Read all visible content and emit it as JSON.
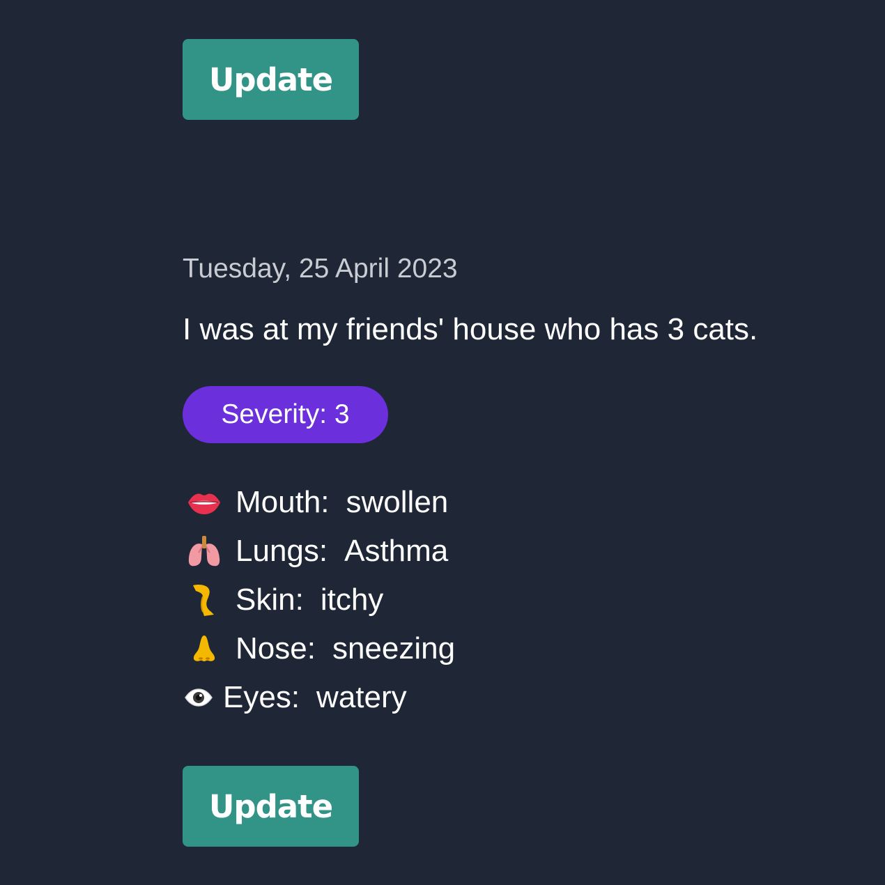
{
  "buttons": {
    "update_top": "Update",
    "update_bottom": "Update"
  },
  "entry": {
    "date": "Tuesday, 25 April 2023",
    "note": "I was at my friends' house who has 3 cats.",
    "severity": "Severity: 3",
    "symptoms": [
      {
        "icon": "lips-icon",
        "part": "Mouth:",
        "value": "swollen"
      },
      {
        "icon": "lungs-icon",
        "part": "Lungs:",
        "value": "Asthma"
      },
      {
        "icon": "leg-icon",
        "part": "Skin:",
        "value": "itchy"
      },
      {
        "icon": "nose-icon",
        "part": "Nose:",
        "value": "sneezing"
      },
      {
        "icon": "eye-icon",
        "part": "Eyes:",
        "value": "watery"
      }
    ]
  },
  "colors": {
    "background": "#1f2736",
    "button": "#329487",
    "severity_badge": "#6b2fdc",
    "date_text": "#c9ccd2",
    "text": "#ffffff"
  }
}
